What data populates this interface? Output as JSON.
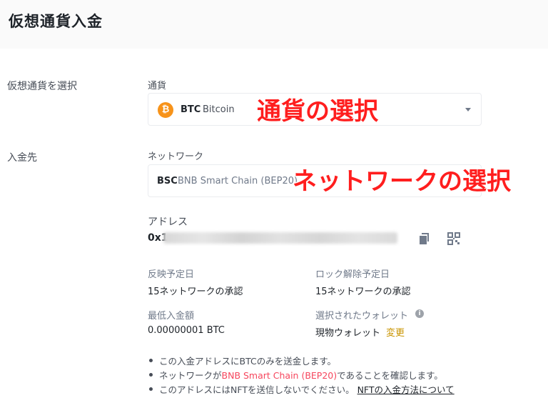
{
  "page": {
    "title": "仮想通貨入金"
  },
  "sections": {
    "select_crypto": "仮想通貨を選択",
    "deposit_to": "入金先"
  },
  "currency": {
    "label": "通貨",
    "icon": "bitcoin-icon",
    "icon_glyph": "₿",
    "symbol": "BTC",
    "name": "Bitcoin"
  },
  "network": {
    "label": "ネットワーク",
    "symbol": "BSC",
    "name": "BNB Smart Chain (BEP20)"
  },
  "annotations": {
    "currency": "通貨の選択",
    "network": "ネットワークの選択"
  },
  "address": {
    "label": "アドレス",
    "prefix": "0x1"
  },
  "info": {
    "credited_label": "反映予定日",
    "credited_value": "15ネットワークの承認",
    "unlock_label": "ロック解除予定日",
    "unlock_value": "15ネットワークの承認",
    "min_label": "最低入金額",
    "min_value": "0.00000001 BTC",
    "wallet_label": "選択されたウォレット",
    "wallet_value": "現物ウォレット",
    "wallet_change": "変更"
  },
  "notes": {
    "n1": "この入金アドレスにBTCのみを送金します。",
    "n2_pre": "ネットワークが",
    "n2_hl": "BNB Smart Chain (BEP20)",
    "n2_post": "であることを確認します。",
    "n3_pre": "このアドレスにはNFTを送信しないでください。",
    "n3_link": "NFTの入金方法について"
  },
  "colors": {
    "accent": "#c99400",
    "bitcoin": "#f7931a",
    "highlight": "#f6465d",
    "annotation": "#ff1e1e"
  }
}
